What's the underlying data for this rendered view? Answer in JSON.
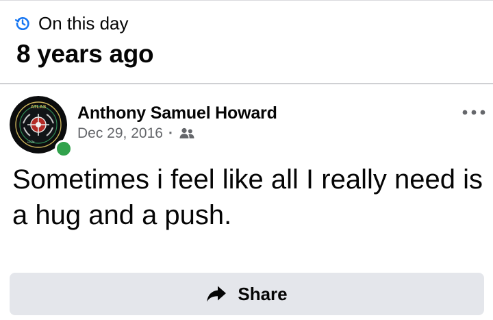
{
  "memories": {
    "label": "On this day",
    "title": "8 years ago",
    "icon": "history-clock-icon"
  },
  "post": {
    "author": "Anthony Samuel Howard",
    "date": "Dec 29, 2016",
    "separator": "·",
    "audience_icon": "friends-icon",
    "status": "online",
    "text": "Sometimes i feel like all I really need is a hug and a push.",
    "avatar_badge_text": "ATLAS",
    "avatar_small_text": "+12s"
  },
  "actions": {
    "share_label": "Share",
    "share_icon": "share-arrow-icon",
    "more_icon": "more-options-icon"
  },
  "colors": {
    "accent_blue": "#1877f2",
    "online_green": "#31a24c",
    "secondary_text": "#65676b",
    "button_bg": "#e4e6eb"
  }
}
